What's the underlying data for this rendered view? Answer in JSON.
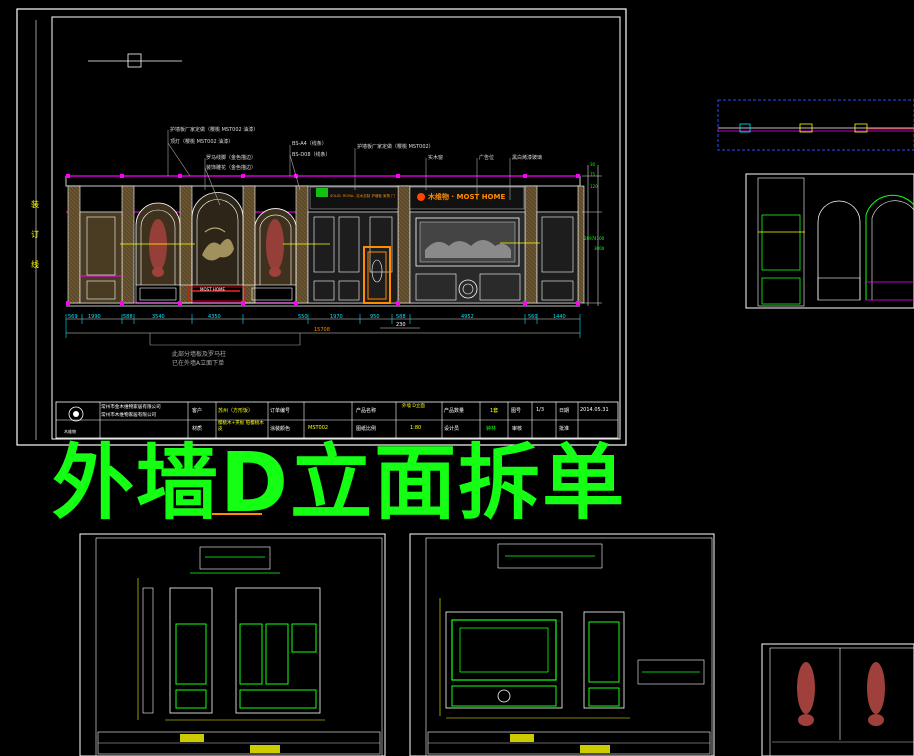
{
  "sheet": {
    "big_title": "外墙D立面拆单",
    "left_margin_label": [
      "装",
      "订",
      "线"
    ]
  },
  "elevation": {
    "callouts": [
      "护墙板厂家定做（樱桃 MST002 油漆）",
      "顶灯（樱桃 MST002 油漆）",
      "罗马线脚（金色描边）",
      "装饰雕花（金色描边）",
      "BS-A4（线条）",
      "BS-D08（线条）",
      "护墙板厂家定做（樱桃 MST002）",
      "实木窗",
      "广告位",
      "黑白烤漆玻璃"
    ],
    "dimensions_bottom": [
      "569",
      "1990",
      "588",
      "3540",
      "4350",
      "550",
      "1970",
      "950",
      "588",
      "4952",
      "560",
      "1440"
    ],
    "dimension_total": "15708",
    "dimension_sub": "230",
    "dimensions_right": [
      "30",
      "75",
      "120",
      "4100",
      "3000",
      "2897"
    ],
    "note_lines": [
      "此部分墙板及罗马柱",
      "已在外墙A立面下单"
    ],
    "brand_text": "木维物 · MOST HOME",
    "brand_small": "SOLID. ROYAL. 实木定制 护墙板 家具 门",
    "door_label": "MOST HOME"
  },
  "title_block": {
    "company_lines": [
      "常州市金木维物家居有限公司",
      "常州市木维物家居有限公司"
    ],
    "logo_text": "木维物",
    "row1": [
      "客户",
      "苏州（方形饭）",
      "订单编号",
      "",
      "产品名称",
      "外墙 D立面",
      "产品数量",
      "1套",
      "图号",
      "1/3",
      "日期",
      "2014.05.31"
    ],
    "row2": [
      "材质",
      "樱桃木+夹板 铂樱桃木皮",
      "涂装颜色",
      "MST002",
      "图纸比例",
      "1:80",
      "设计员",
      "钟林",
      "审核",
      "",
      "批准",
      ""
    ]
  },
  "colors": {
    "frame": "#ffffff",
    "accent_green": "#15ff15",
    "magenta": "#ff00ff",
    "cyan": "#00e5ff",
    "yellow": "#ffff00",
    "orange": "#ff8c00",
    "red_carving": "#a0403c",
    "panel_brown": "#6b5530",
    "blue_dashed": "#2a4cff"
  }
}
